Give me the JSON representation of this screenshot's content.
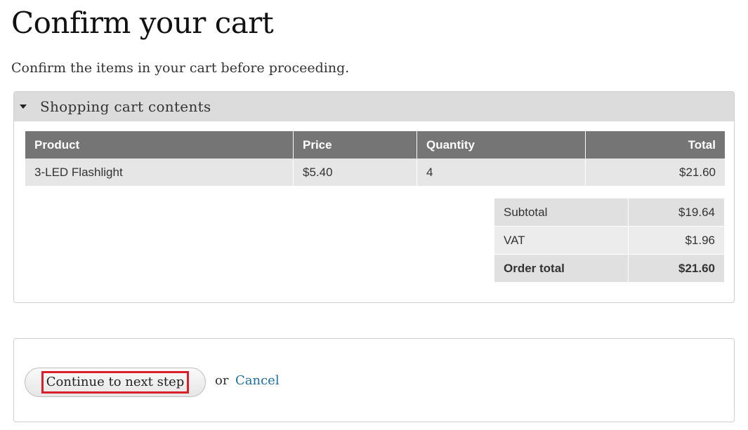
{
  "page": {
    "title": "Confirm your cart",
    "intro": "Confirm the items in your cart before proceeding."
  },
  "cart": {
    "legend": "Shopping cart contents",
    "headers": {
      "product": "Product",
      "price": "Price",
      "quantity": "Quantity",
      "total": "Total"
    },
    "rows": [
      {
        "product": "3-LED Flashlight",
        "price": "$5.40",
        "quantity": "4",
        "total": "$21.60"
      }
    ],
    "totals": {
      "subtotal_label": "Subtotal",
      "subtotal_value": "$19.64",
      "vat_label": "VAT",
      "vat_value": "$1.96",
      "order_total_label": "Order total",
      "order_total_value": "$21.60"
    }
  },
  "actions": {
    "continue_label": "Continue to next step",
    "or_text": "or",
    "cancel_label": "Cancel"
  },
  "colors": {
    "header_bg": "#757575",
    "legend_bg": "#dcdcdc",
    "link": "#1a6fa0",
    "highlight_outline": "#d9202a"
  }
}
